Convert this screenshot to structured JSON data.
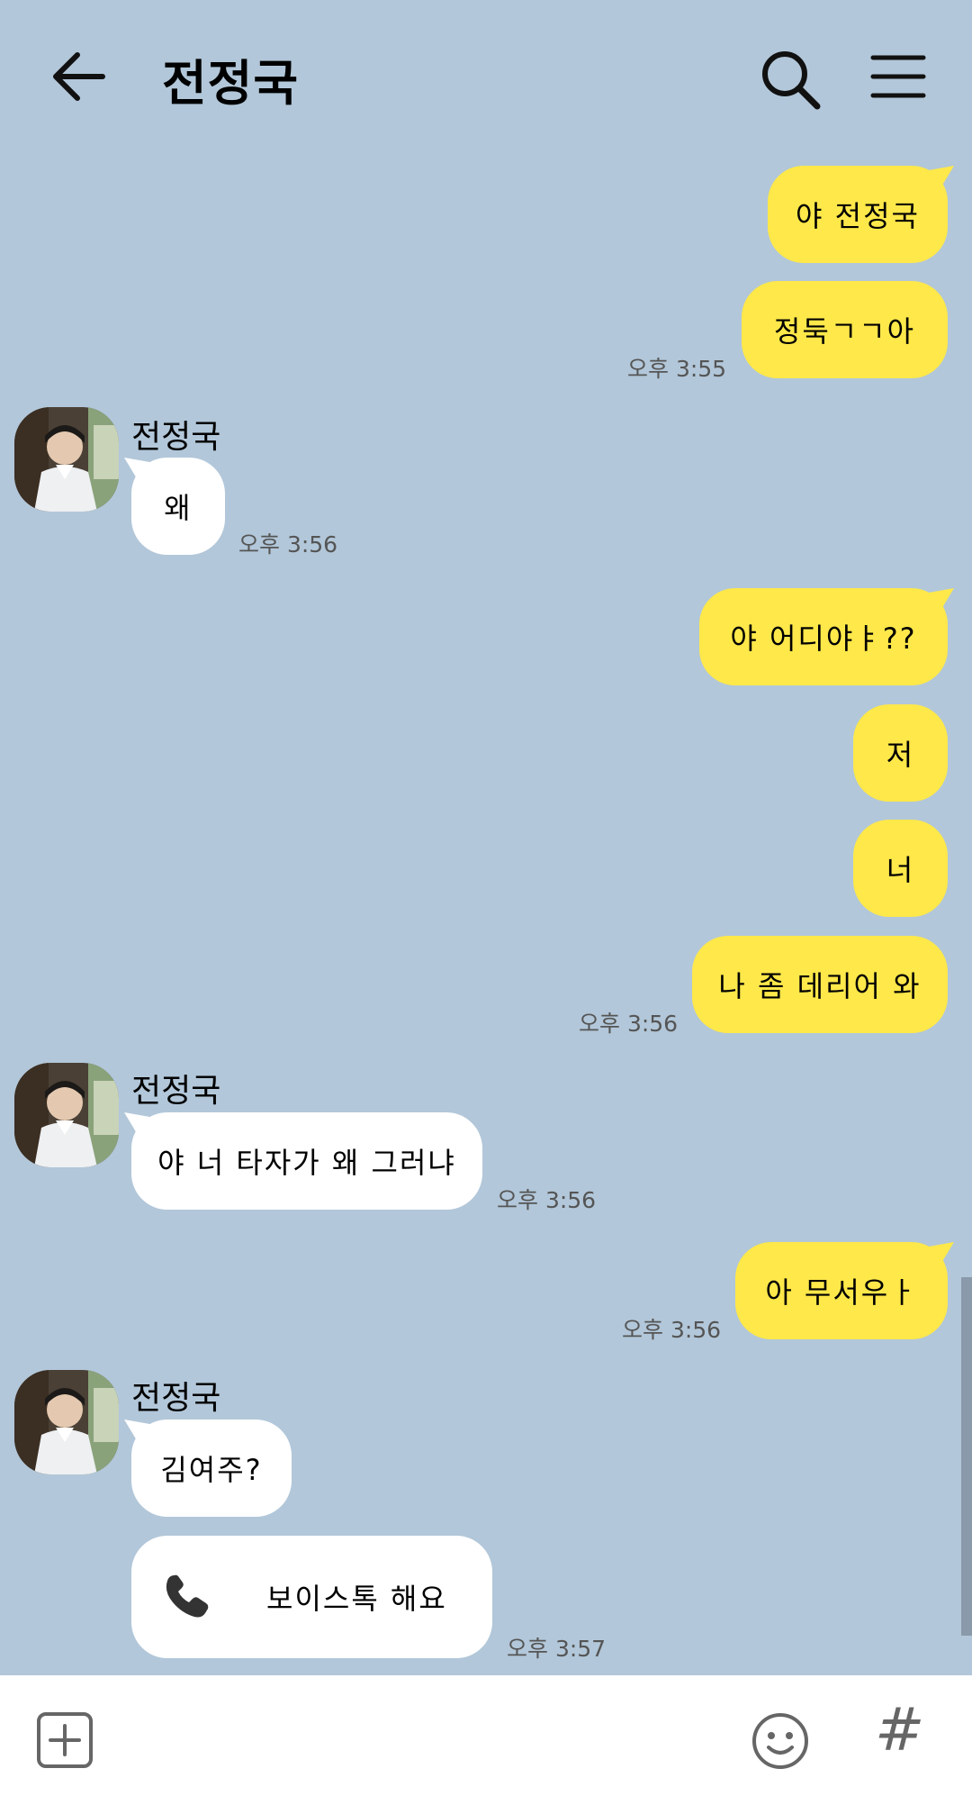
{
  "header": {
    "title": "전정국",
    "back_icon": "arrow-left-icon",
    "search_icon": "search-icon",
    "menu_icon": "hamburger-menu-icon"
  },
  "colors": {
    "background": "#b2c7d9",
    "my_bubble": "#fee84a",
    "their_bubble": "#ffffff"
  },
  "messages": [
    {
      "from": "me",
      "text": "야 전정국"
    },
    {
      "from": "me",
      "text": "정둑ㄱㄱ아",
      "time": "오후 3:55"
    },
    {
      "from": "them",
      "sender": "전정국",
      "text": "왜",
      "time": "오후 3:56"
    },
    {
      "from": "me",
      "text": "야 어디야ㅑ??"
    },
    {
      "from": "me",
      "text": "저"
    },
    {
      "from": "me",
      "text": "너"
    },
    {
      "from": "me",
      "text": "나 좀 데리어 와",
      "time": "오후 3:56"
    },
    {
      "from": "them",
      "sender": "전정국",
      "text": "야 너 타자가 왜 그러냐",
      "time": "오후 3:56"
    },
    {
      "from": "me",
      "text": "아 무서우ㅏ",
      "time": "오후 3:56"
    },
    {
      "from": "them",
      "sender": "전정국",
      "text": "김여주?"
    },
    {
      "from": "them",
      "type": "voice-talk",
      "icon": "phone-icon",
      "text": "보이스톡 해요",
      "time": "오후 3:57"
    }
  ],
  "input_bar": {
    "add_icon": "plus-square-icon",
    "emoji_icon": "smiley-icon",
    "hash_icon": "hashtag-icon",
    "hash_label": "#"
  }
}
